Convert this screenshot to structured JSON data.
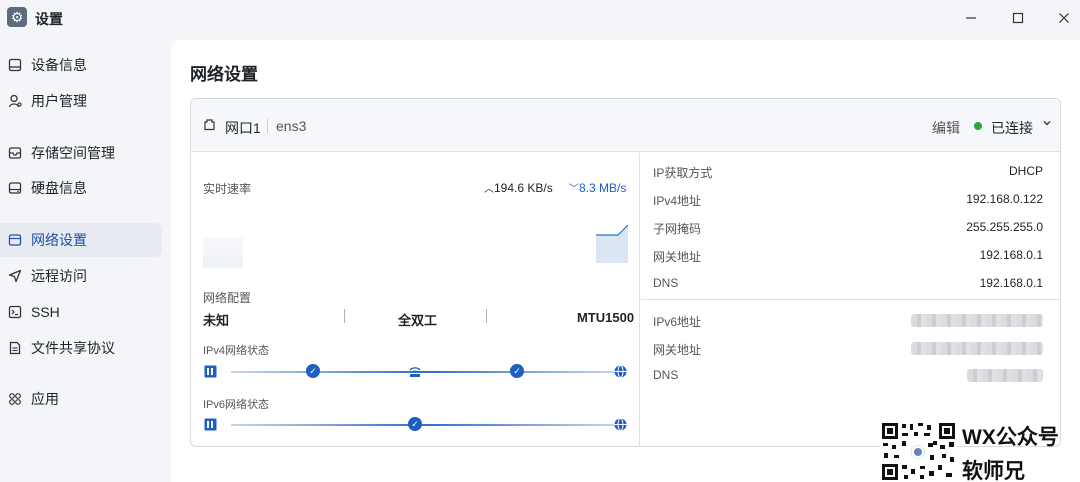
{
  "window": {
    "title": "设置"
  },
  "sidebar": {
    "items": [
      {
        "label": "设备信息",
        "icon": "device-icon"
      },
      {
        "label": "用户管理",
        "icon": "user-icon"
      },
      {
        "label": "存储空间管理",
        "icon": "storage-icon"
      },
      {
        "label": "硬盘信息",
        "icon": "disk-icon"
      },
      {
        "label": "网络设置",
        "icon": "network-icon",
        "active": true
      },
      {
        "label": "远程访问",
        "icon": "send-icon"
      },
      {
        "label": "SSH",
        "icon": "terminal-icon"
      },
      {
        "label": "文件共享协议",
        "icon": "file-icon"
      },
      {
        "label": "应用",
        "icon": "apps-icon"
      }
    ]
  },
  "main": {
    "title": "网络设置",
    "card": {
      "port_label": "网口1",
      "interface": "ens3",
      "edit_label": "编辑",
      "status": "已连接",
      "status_color": "#26a843",
      "speed": {
        "label": "实时速率",
        "upload": "194.6 KB/s",
        "download": "8.3 MB/s"
      },
      "config": {
        "label": "网络配置",
        "speed": "未知",
        "duplex": "全双工",
        "mtu": "MTU1500"
      },
      "ipv4_status_label": "IPv4网络状态",
      "ipv6_status_label": "IPv6网络状态",
      "ipv4": [
        {
          "label": "IP获取方式",
          "value": "DHCP"
        },
        {
          "label": "IPv4地址",
          "value": "192.168.0.122"
        },
        {
          "label": "子网掩码",
          "value": "255.255.255.0"
        },
        {
          "label": "网关地址",
          "value": "192.168.0.1"
        },
        {
          "label": "DNS",
          "value": "192.168.0.1"
        }
      ],
      "ipv6": [
        {
          "label": "IPv6地址"
        },
        {
          "label": "网关地址"
        },
        {
          "label": "DNS"
        }
      ]
    }
  },
  "watermark": {
    "line1": "WX公众号",
    "line2": "软师兄"
  },
  "colors": {
    "accent": "#1f5fc0",
    "active_bg": "#e8ecf2"
  }
}
